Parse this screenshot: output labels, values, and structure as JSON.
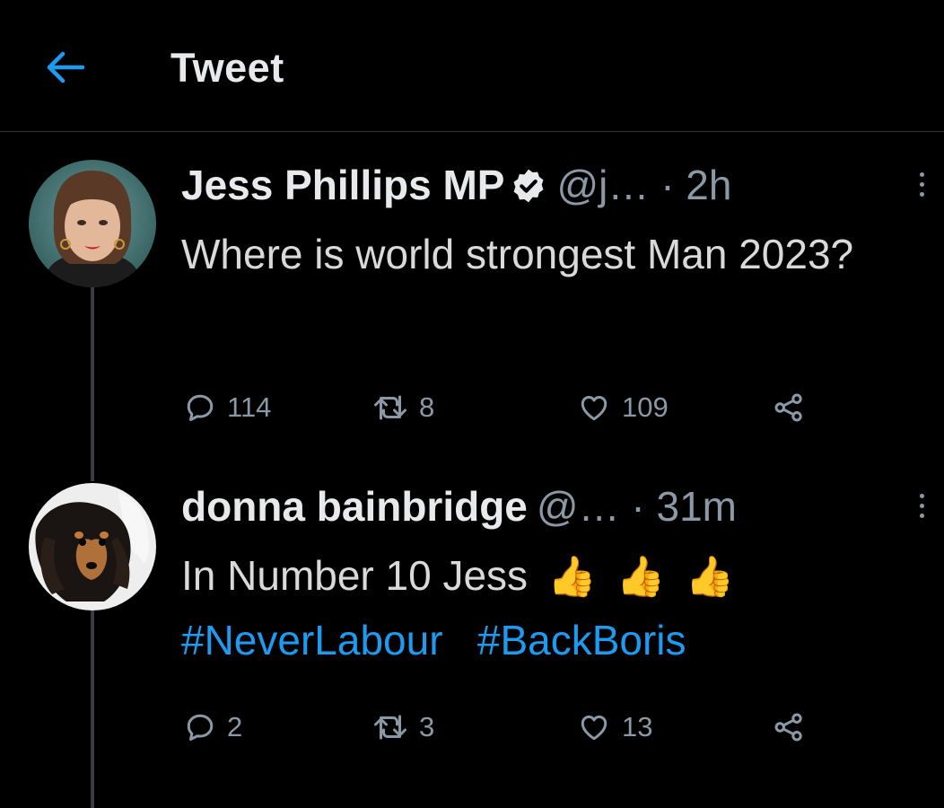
{
  "header": {
    "title": "Tweet",
    "back_icon": "arrow-left-icon"
  },
  "colors": {
    "accent": "#1d9bf0",
    "background": "#000000",
    "muted": "#8b98a5"
  },
  "tweets": [
    {
      "name": "Jess Phillips MP",
      "verified": true,
      "handle": "@j…",
      "separator": "·",
      "time": "2h",
      "text": "Where is world strongest Man 2023?",
      "replies": "114",
      "retweets": "8",
      "likes": "109"
    },
    {
      "name": "donna bainbridge",
      "verified": false,
      "handle": "@…",
      "separator": "·",
      "time": "31m",
      "text": "In Number 10 Jess",
      "emoji": [
        "👍",
        "👍",
        "👍"
      ],
      "hashtags": [
        "#NeverLabour",
        "#BackBoris"
      ],
      "replies": "2",
      "retweets": "3",
      "likes": "13"
    }
  ]
}
